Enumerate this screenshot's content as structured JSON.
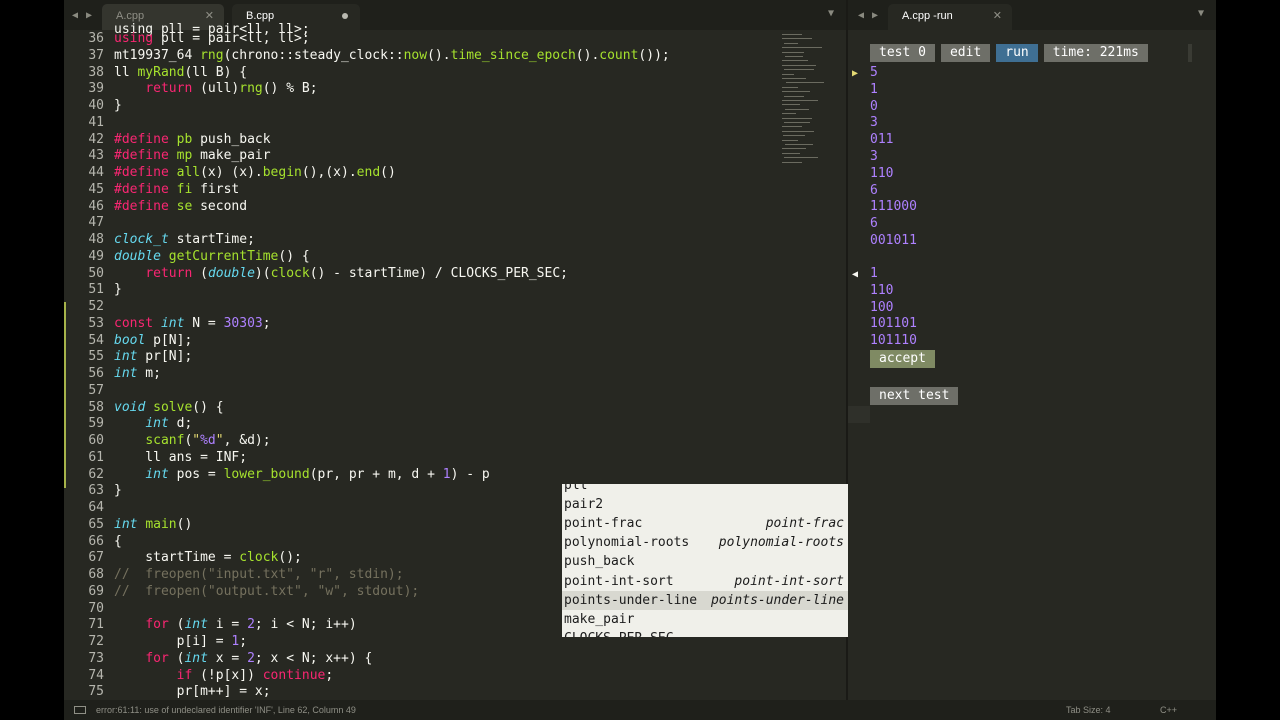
{
  "tabs_left": [
    {
      "label": "A.cpp",
      "active": false
    },
    {
      "label": "B.cpp",
      "active": true
    }
  ],
  "tabs_right": [
    {
      "label": "A.cpp -run",
      "active": true
    }
  ],
  "editor": {
    "lines": [
      {
        "n": "36",
        "html": "<span class='k'>using</span> pll = pair&lt;ll, ll&gt;;"
      },
      {
        "n": "37",
        "html": "mt19937_64 <span class='f'>rng</span>(chrono::steady_clock::<span class='f'>now</span>().<span class='f'>time_since_epoch</span>().<span class='f'>count</span>());"
      },
      {
        "n": "38",
        "html": "ll <span class='f'>myRand</span>(ll B) {"
      },
      {
        "n": "39",
        "html": "    <span class='k'>return</span> (ull)<span class='f'>rng</span>() % B;"
      },
      {
        "n": "40",
        "html": "}"
      },
      {
        "n": "41",
        "html": ""
      },
      {
        "n": "42",
        "html": "<span class='k'>#define</span> <span class='f'>pb</span> push_back"
      },
      {
        "n": "43",
        "html": "<span class='k'>#define</span> <span class='f'>mp</span> make_pair"
      },
      {
        "n": "44",
        "html": "<span class='k'>#define</span> <span class='f'>all</span>(x) (x).<span class='f'>begin</span>(),(x).<span class='f'>end</span>()"
      },
      {
        "n": "45",
        "html": "<span class='k'>#define</span> <span class='f'>fi</span> first"
      },
      {
        "n": "46",
        "html": "<span class='k'>#define</span> <span class='f'>se</span> second"
      },
      {
        "n": "47",
        "html": ""
      },
      {
        "n": "48",
        "html": "<span class='t'>clock_t</span> startTime;"
      },
      {
        "n": "49",
        "html": "<span class='t'>double</span> <span class='f'>getCurrentTime</span>() {"
      },
      {
        "n": "50",
        "html": "    <span class='k'>return</span> (<span class='t'>double</span>)(<span class='f'>clock</span>() - startTime) / CLOCKS_PER_SEC;"
      },
      {
        "n": "51",
        "html": "}"
      },
      {
        "n": "52",
        "html": ""
      },
      {
        "n": "53",
        "html": "<span class='k'>const</span> <span class='t'>int</span> N = <span class='n'>30303</span>;"
      },
      {
        "n": "54",
        "html": "<span class='t'>bool</span> p[N];"
      },
      {
        "n": "55",
        "html": "<span class='t'>int</span> pr[N];"
      },
      {
        "n": "56",
        "html": "<span class='t'>int</span> m;"
      },
      {
        "n": "57",
        "html": ""
      },
      {
        "n": "58",
        "html": "<span class='t'>void</span> <span class='f'>solve</span>() {"
      },
      {
        "n": "59",
        "html": "    <span class='t'>int</span> d;"
      },
      {
        "n": "60",
        "html": "    <span class='f'>scanf</span>(<span class='s'>\"</span><span class='n'>%d</span><span class='s'>\"</span>, &amp;d);"
      },
      {
        "n": "61",
        "html": "    ll ans = INF;"
      },
      {
        "n": "62",
        "html": "    <span class='t'>int</span> pos = <span class='f'>lower_bound</span>(pr, pr + m, d + <span class='n'>1</span>) - p"
      },
      {
        "n": "63",
        "html": "}"
      },
      {
        "n": "64",
        "html": ""
      },
      {
        "n": "65",
        "html": "<span class='t'>int</span> <span class='f'>main</span>()"
      },
      {
        "n": "66",
        "html": "{"
      },
      {
        "n": "67",
        "html": "    startTime = <span class='f'>clock</span>();"
      },
      {
        "n": "68",
        "html": "<span class='c'>//  freopen(\"input.txt\", \"r\", stdin);</span>"
      },
      {
        "n": "69",
        "html": "<span class='c'>//  freopen(\"output.txt\", \"w\", stdout);</span>"
      },
      {
        "n": "70",
        "html": ""
      },
      {
        "n": "71",
        "html": "    <span class='k'>for</span> (<span class='t'>int</span> i = <span class='n'>2</span>; i &lt; N; i++)"
      },
      {
        "n": "72",
        "html": "        p[i] = <span class='n'>1</span>;"
      },
      {
        "n": "73",
        "html": "    <span class='k'>for</span> (<span class='t'>int</span> x = <span class='n'>2</span>; x &lt; N; x++) {"
      },
      {
        "n": "74",
        "html": "        <span class='k'>if</span> (!p[x]) <span class='k'>continue</span>;"
      },
      {
        "n": "75",
        "html": "        pr[m++] = x;"
      }
    ],
    "top_partial": "using pll = pair<ll, ll>;"
  },
  "autocomplete": {
    "items": [
      {
        "label": "pll",
        "hint": "",
        "selected": false
      },
      {
        "label": "pair2",
        "hint": "",
        "selected": false
      },
      {
        "label": "point-frac",
        "hint": "point-frac",
        "selected": false
      },
      {
        "label": "polynomial-roots",
        "hint": "polynomial-roots",
        "selected": false
      },
      {
        "label": "push_back",
        "hint": "",
        "selected": false
      },
      {
        "label": "point-int-sort",
        "hint": "point-int-sort",
        "selected": false
      },
      {
        "label": "points-under-line",
        "hint": "points-under-line",
        "selected": true
      },
      {
        "label": "make_pair",
        "hint": "",
        "selected": false
      },
      {
        "label": "CLOCKS_PER_SEC",
        "hint": "",
        "selected": false
      }
    ]
  },
  "run_panel": {
    "test_label": "test 0",
    "edit_label": "edit",
    "run_label": "run",
    "time_label": "time: 221ms",
    "input_lines": [
      "5",
      "1",
      "0",
      "3",
      "011",
      "3",
      "110",
      "6",
      "111000",
      "6",
      "001011"
    ],
    "output_lines": [
      "1",
      "110",
      "100",
      "101101",
      "101110"
    ],
    "accept_label": "accept",
    "next_test_label": "next test",
    "input_marker_color": "#e6db74",
    "output_marker_color": "#f8f8f2"
  },
  "statusbar": {
    "message": "error:61:11: use of undeclared identifier 'INF', Line 62, Column 49",
    "tab_size": "Tab Size: 4",
    "language": "C++"
  }
}
